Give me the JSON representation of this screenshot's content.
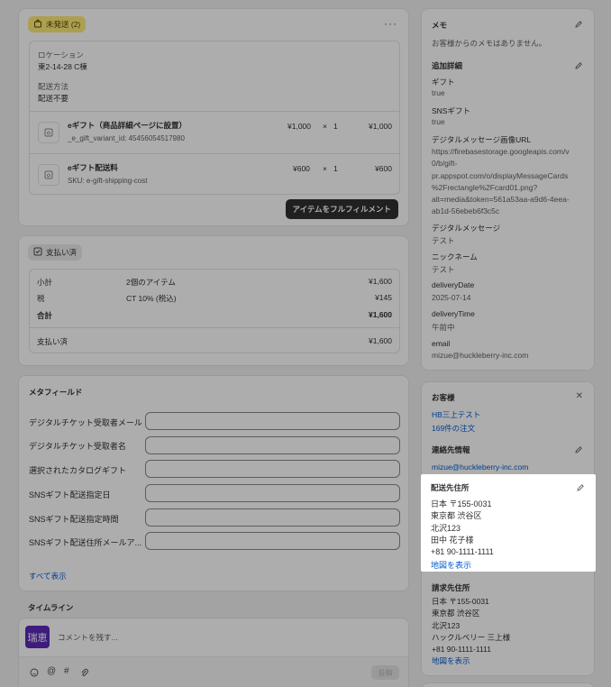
{
  "fulfillment": {
    "badge": "未発送 (2)",
    "location_label": "ロケーション",
    "location_value": "東2-14-28 C棟",
    "delivery_label": "配送方法",
    "delivery_value": "配送不要",
    "items": [
      {
        "name": "eギフト（商品詳細ページに設置）",
        "sub": "_e_gift_variant_id: 45456054517980",
        "price": "¥1,000",
        "times": "×",
        "qty": "1",
        "total": "¥1,000"
      },
      {
        "name": "eギフト配送料",
        "sub": "SKU: e-gift-shipping-cost",
        "price": "¥600",
        "times": "×",
        "qty": "1",
        "total": "¥600"
      }
    ],
    "fulfill_button": "アイテムをフルフィルメント"
  },
  "payment": {
    "badge": "支払い済",
    "rows": [
      {
        "label": "小計",
        "desc": "2個のアイテム",
        "value": "¥1,600"
      },
      {
        "label": "税",
        "desc": "CT 10% (税込)",
        "value": "¥145"
      },
      {
        "label": "合計",
        "desc": "",
        "value": "¥1,600"
      }
    ],
    "paid_label": "支払い済",
    "paid_value": "¥1,600"
  },
  "metafields": {
    "title": "メタフィールド",
    "fields": [
      "デジタルチケット受取者メール",
      "デジタルチケット受取者名",
      "選択されたカタログギフト",
      "SNSギフト配送指定日",
      "SNSギフト配送指定時間",
      "SNSギフト配送住所メールア..."
    ],
    "show_all": "すべて表示"
  },
  "timeline": {
    "title": "タイムライン",
    "avatar": "瑞恵",
    "placeholder": "コメントを残す...",
    "post_button": "投稿"
  },
  "notes": {
    "title": "メモ",
    "empty": "お客様からのメモはありません。",
    "additional_title": "追加詳細",
    "details": [
      {
        "key": "ギフト",
        "value": "true"
      },
      {
        "key": "SNSギフト",
        "value": "true"
      },
      {
        "key": "デジタルメッセージ画像URL",
        "value_lines": [
          "https://firebasestorage.googleapis.com/v",
          "0/b/gift-",
          "pr.appspot.com/o/displayMessageCards",
          "%2Frectangle%2Fcard01.png?",
          "alt=media&token=561a53aa-a9d6-4eea-",
          "ab1d-56ebeb6f3c5c"
        ]
      },
      {
        "key": "デジタルメッセージ",
        "value": "テスト"
      },
      {
        "key": "ニックネーム",
        "value": "テスト"
      },
      {
        "key": "deliveryDate",
        "value": "2025-07-14"
      },
      {
        "key": "deliveryTime",
        "value": "午前中"
      },
      {
        "key": "email",
        "value": "mizue@huckleberry-inc.com"
      }
    ]
  },
  "customer": {
    "title": "お客様",
    "name": "HB三上テスト",
    "orders": "169件の注文",
    "contact_title": "連絡先情報",
    "email": "mizue@huckleberry-inc.com",
    "shipping_title": "配送先住所",
    "shipping_lines": [
      "日本 〒155-0031",
      "東京都 渋谷区",
      "北沢123",
      "田中 花子様",
      "+81 90-1111-1111"
    ],
    "map_link": "地図を表示",
    "billing_title": "請求先住所",
    "billing_lines": [
      "日本 〒155-0031",
      "東京都 渋谷区",
      "北沢123",
      "ハックルベリー 三上様",
      "+81 90-1111-1111"
    ],
    "billing_map_link": "地図を表示"
  }
}
